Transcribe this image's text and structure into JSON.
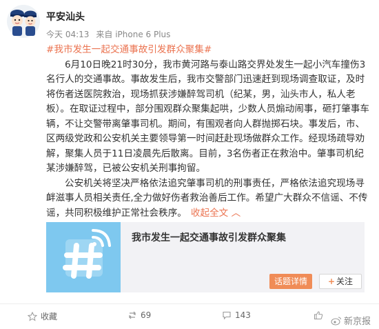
{
  "account": {
    "name": "平安汕头"
  },
  "meta": {
    "time": "今天 04:13",
    "source": "来自 iPhone 6 Plus"
  },
  "post": {
    "headline": "#我市发生一起交通事故引发群众聚集#",
    "paragraph1": "6月10日晚21时30分，我市黄河路与泰山路交界处发生一起小汽车撞伤3名行人的交通事故。事故发生后，我市交警部门迅速赶到现场调查取证，及时将伤者送医院救治，现场抓获涉嫌醉驾司机（纪某，男，汕头市人，私人老板）。在取证过程中，部分围观群众聚集起哄，少数人员煽动闹事，砸打肇事车辆，不让交警带离肇事司机。期间，有围观者向人群抛掷石块。事发后，市、区两级党政和公安机关主要领导第一时间赶赴现场做群众工作。经现场疏导劝解，聚集人员于11日凌晨先后散离。目前，3名伤者正在救治中。肇事司机纪某涉嫌醉驾，已被公安机关刑事拘留。",
    "paragraph2": "公安机关将坚决严格依法追究肇事司机的刑事责任，严格依法追究现场寻衅滋事人员相关责任,全力做好伤者救治善后工作。希望广大群众不信谣、不传谣，共同积极维护正常社会秩序。",
    "collapse": "收起全文 ︿"
  },
  "card": {
    "title": "我市发生一起交通事故引发群众聚集",
    "topic_button": "话题详情",
    "follow_button": "关注",
    "thumb_color": "#7ec8ef"
  },
  "footer": {
    "favorite": "收藏",
    "repost_count": "69",
    "comment_count": "143",
    "watermark": "新京报"
  }
}
